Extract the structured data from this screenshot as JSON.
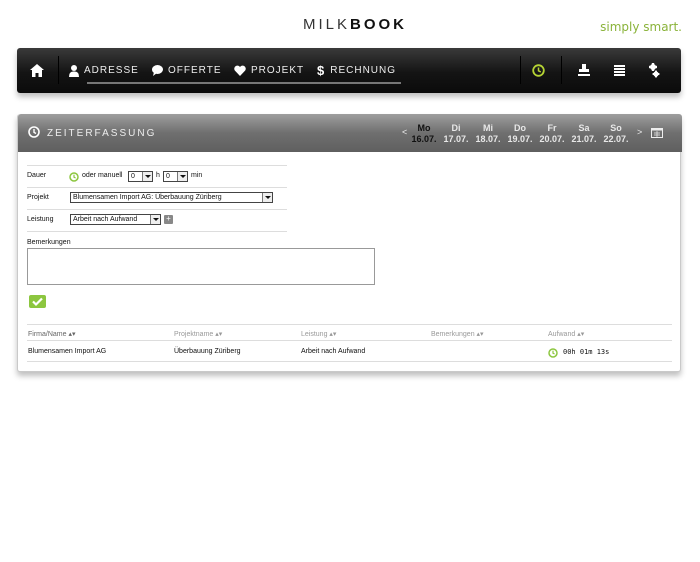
{
  "header": {
    "logo_light": "MILK",
    "logo_bold": "BOOK",
    "tagline": "simply smart."
  },
  "nav": {
    "items": [
      "ADRESSE",
      "OFFERTE",
      "PROJEKT",
      "RECHNUNG"
    ]
  },
  "panel": {
    "title": "ZEITERFASSUNG",
    "prev": "<",
    "next": ">",
    "days": [
      {
        "name": "Mo",
        "date": "16.07."
      },
      {
        "name": "Di",
        "date": "17.07."
      },
      {
        "name": "Mi",
        "date": "18.07."
      },
      {
        "name": "Do",
        "date": "19.07."
      },
      {
        "name": "Fr",
        "date": "20.07."
      },
      {
        "name": "Sa",
        "date": "21.07."
      },
      {
        "name": "So",
        "date": "22.07."
      }
    ]
  },
  "form": {
    "dauer_label": "Dauer",
    "manual_text": "oder manuell",
    "hours_value": "0",
    "hours_unit": "h",
    "minutes_value": "0",
    "minutes_unit": "min",
    "projekt_label": "Projekt",
    "projekt_value": "Blumensamen Import AG: Überbauung Züriberg",
    "leistung_label": "Leistung",
    "leistung_value": "Arbeit nach Aufwand",
    "bemerkungen_label": "Bemerkungen",
    "bemerkungen_value": ""
  },
  "table": {
    "headers": [
      "Firma/Name",
      "Projektname",
      "Leistung",
      "Bemerkungen",
      "Aufwand"
    ],
    "rows": [
      {
        "firma": "Blumensamen Import AG",
        "projekt": "Überbauung Züriberg",
        "leistung": "Arbeit nach Aufwand",
        "bemerkungen": "",
        "aufwand": "00h 01m 13s"
      }
    ]
  },
  "colors": {
    "accent": "#8cc63f",
    "tagline": "#8ab33a",
    "navbar": "#141414",
    "panel_header": "#6f6f6f"
  }
}
